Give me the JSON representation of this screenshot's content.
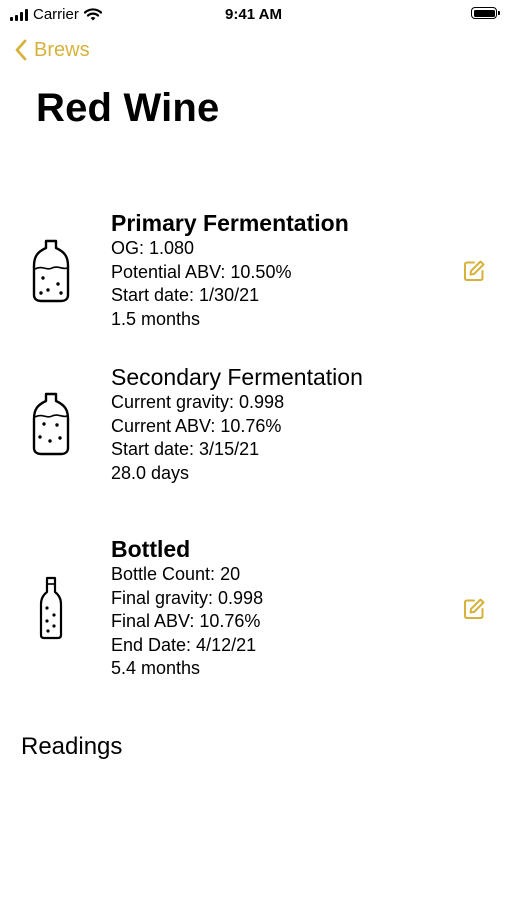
{
  "status_bar": {
    "carrier": "Carrier",
    "time": "9:41 AM"
  },
  "nav": {
    "back_label": "Brews"
  },
  "page": {
    "title": "Red Wine"
  },
  "stages": {
    "primary": {
      "title": "Primary Fermentation",
      "lines": [
        "OG: 1.080",
        "Potential ABV: 10.50%",
        "Start date: 1/30/21",
        "1.5 months"
      ],
      "icon": "carboy-icon"
    },
    "secondary": {
      "title": "Secondary Fermentation",
      "lines": [
        "Current gravity: 0.998",
        "Current ABV: 10.76%",
        "Start date: 3/15/21",
        "28.0 days"
      ],
      "icon": "carboy-icon"
    },
    "bottled": {
      "title": "Bottled",
      "lines": [
        "Bottle Count: 20",
        "Final gravity: 0.998",
        "Final ABV: 10.76%",
        "End Date: 4/12/21",
        "5.4 months"
      ],
      "icon": "bottle-icon"
    }
  },
  "readings": {
    "heading": "Readings"
  },
  "colors": {
    "accent": "#d6b23c",
    "text": "#000000",
    "background": "#ffffff"
  }
}
